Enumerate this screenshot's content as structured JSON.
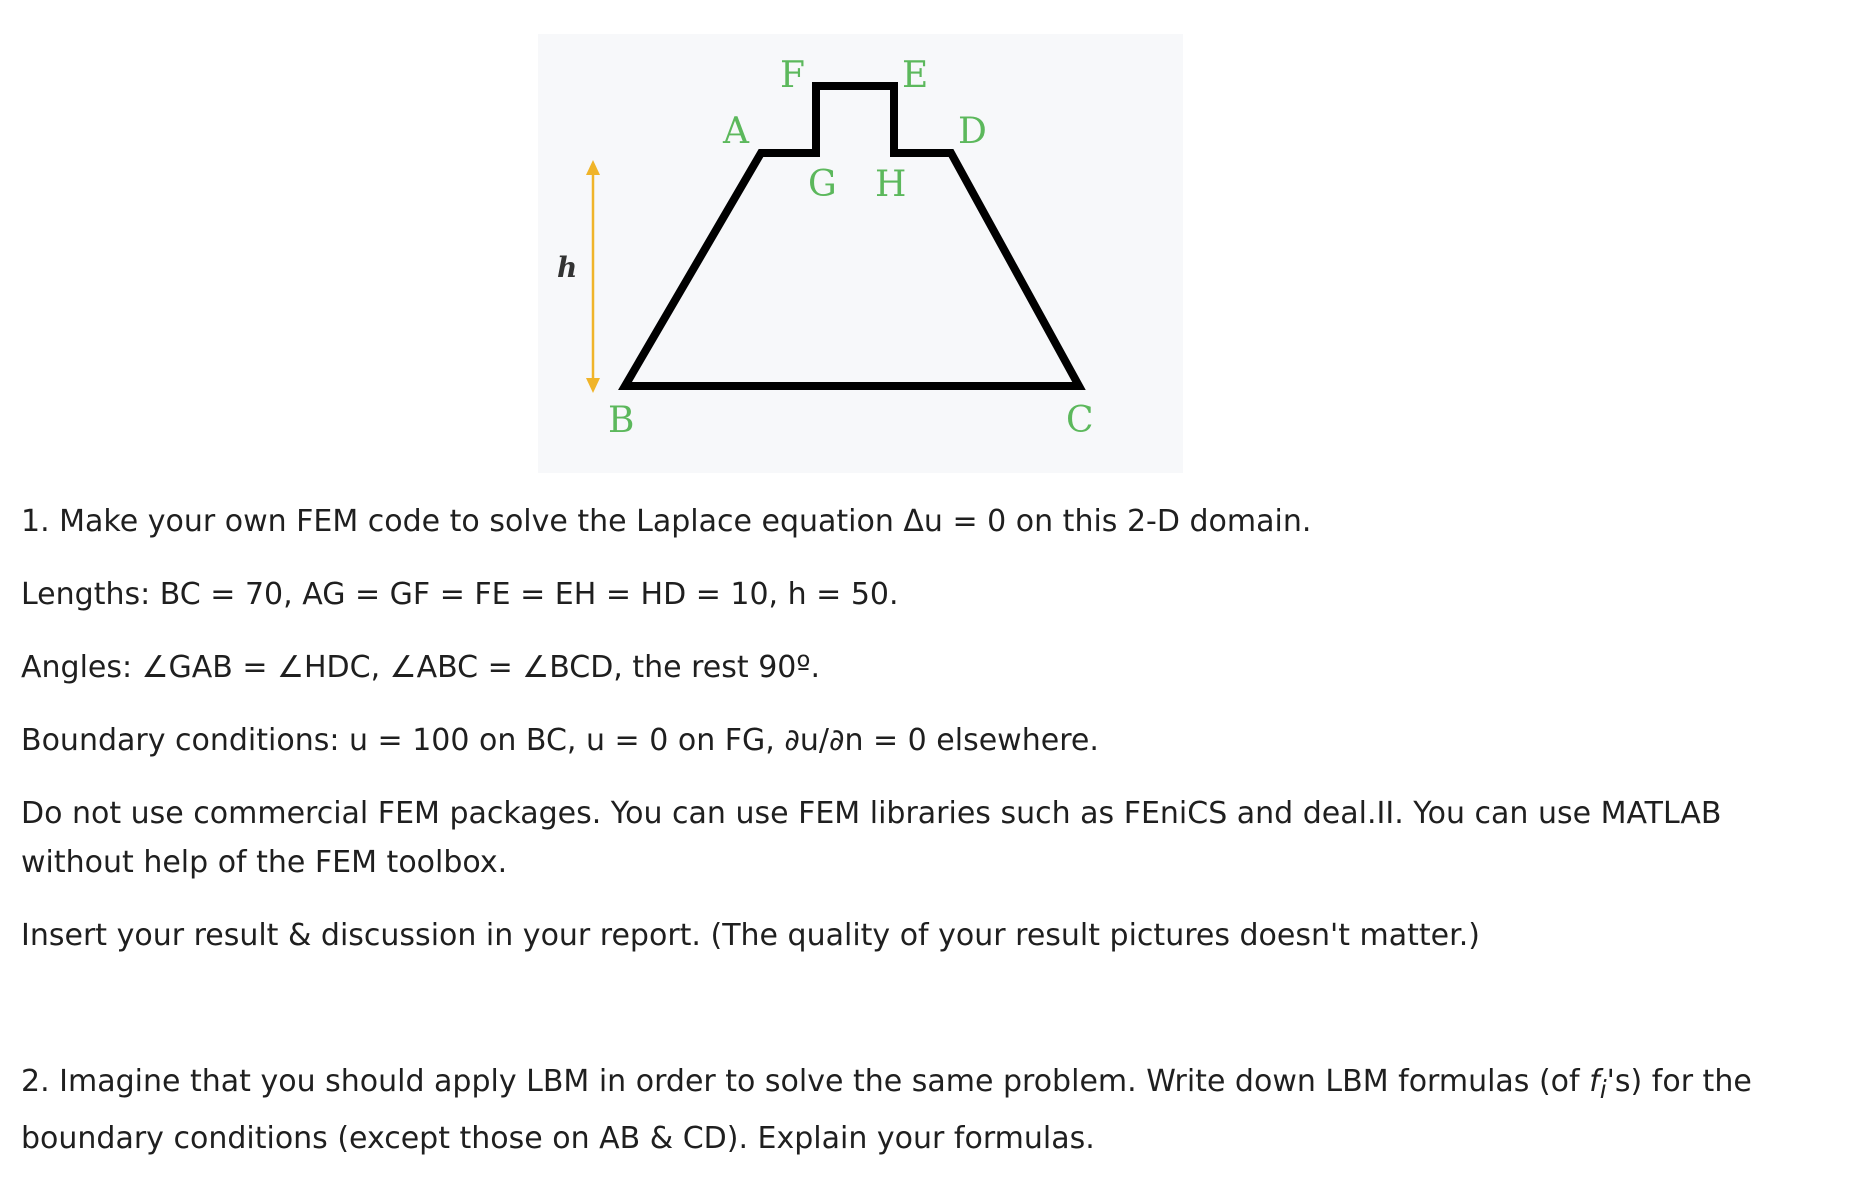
{
  "figure": {
    "labels": {
      "A": "A",
      "B": "B",
      "C": "C",
      "D": "D",
      "E": "E",
      "F": "F",
      "G": "G",
      "H": "H",
      "h": "h"
    },
    "colors": {
      "labels": "#5cb85c",
      "arrow": "#f0b429",
      "outline": "#000000",
      "background": "#f7f8fa"
    }
  },
  "text": {
    "q1": "1. Make your own FEM code to solve the Laplace equation Δu = 0 on this 2-D domain.",
    "lengths": "Lengths: BC = 70, AG = GF = FE = EH = HD = 10, h = 50.",
    "angles": "Angles: ∠GAB = ∠HDC, ∠ABC = ∠BCD, the rest 90º.",
    "boundary": "Boundary conditions: u = 100 on BC, u = 0 on FG, ∂u/∂n = 0 elsewhere.",
    "packages": "Do not use commercial FEM packages. You can use FEM libraries such as FEniCS and deal.II. You can use MATLAB without help of the FEM toolbox.",
    "report": "Insert your result & discussion in your report. (The quality of your result pictures doesn't matter.)",
    "q2_before": "2. Imagine that you should apply LBM in order to solve the same problem. Write down LBM formulas (of ",
    "q2_f": "f",
    "q2_sub": "i",
    "q2_after": "'s) for the boundary conditions (except those on AB & CD). Explain your formulas."
  }
}
